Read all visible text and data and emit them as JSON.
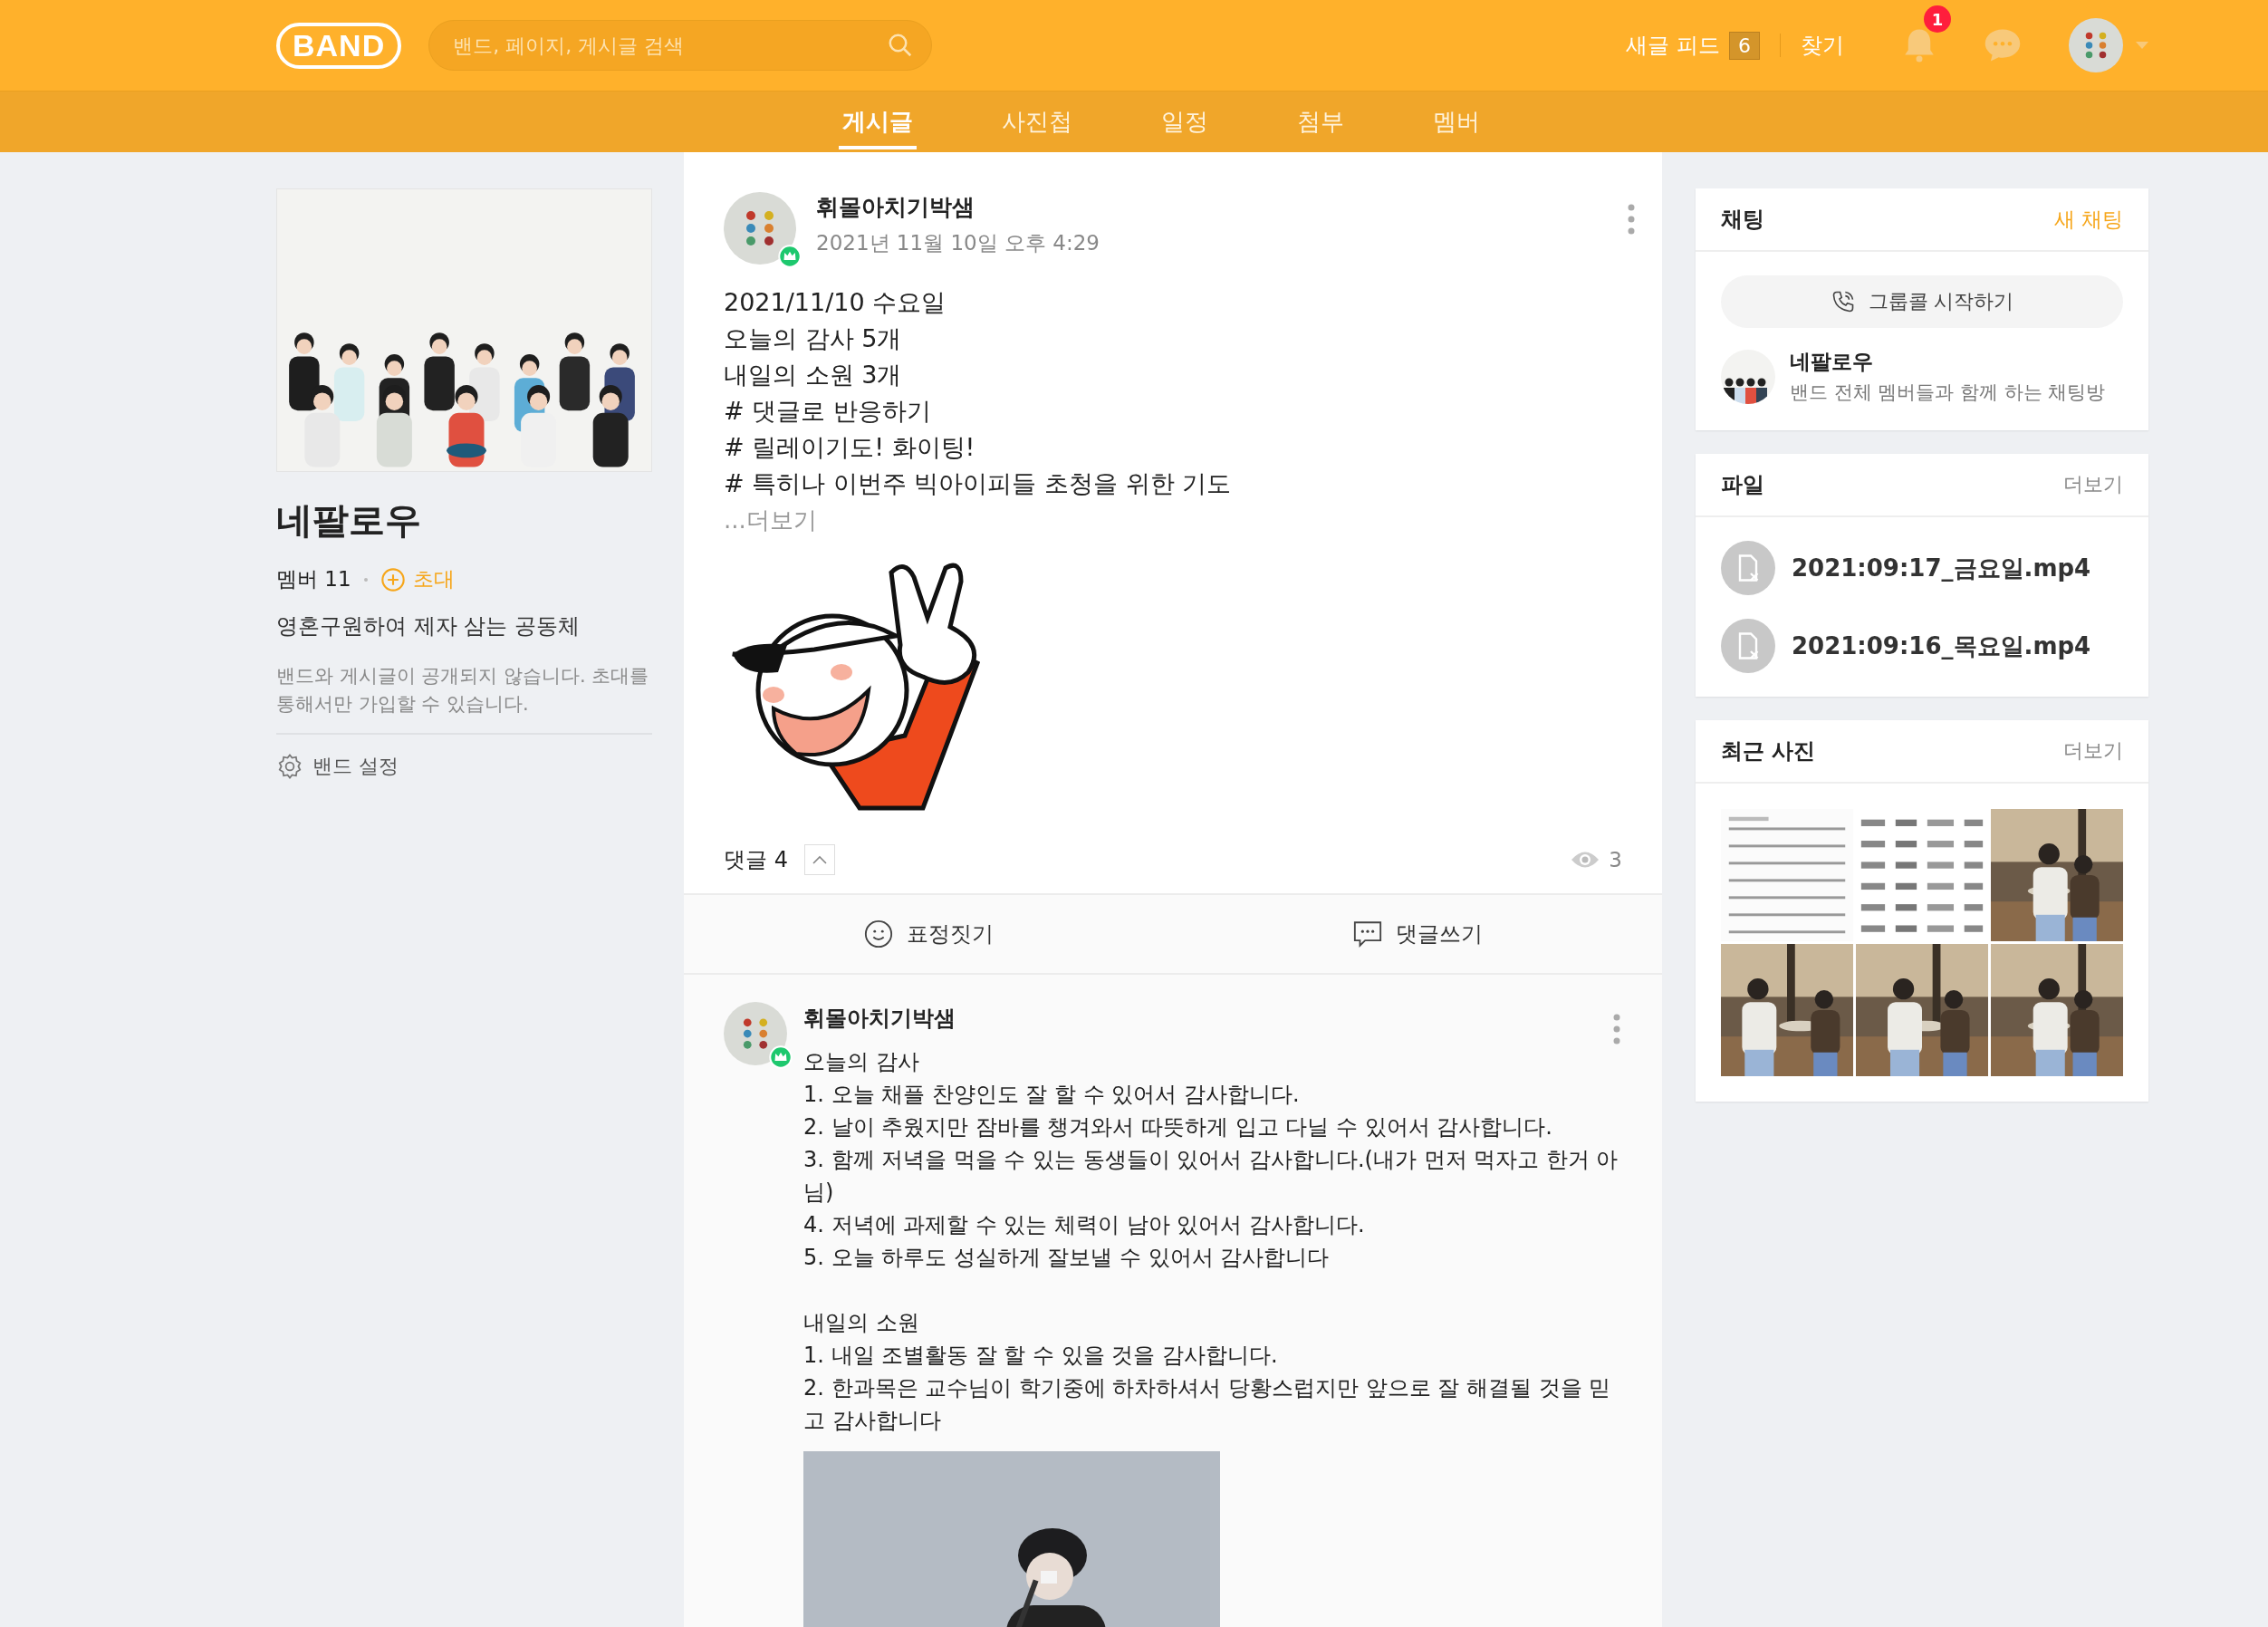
{
  "header": {
    "logo": "BAND",
    "search": {
      "placeholder": "밴드, 페이지, 게시글 검색"
    },
    "feed_label": "새글 피드",
    "feed_count": "6",
    "find": "찾기",
    "notification_count": "1"
  },
  "nav_tabs": [
    {
      "label": "게시글",
      "selected": true
    },
    {
      "label": "사진첩",
      "selected": false
    },
    {
      "label": "일정",
      "selected": false
    },
    {
      "label": "첨부",
      "selected": false
    },
    {
      "label": "멤버",
      "selected": false
    }
  ],
  "band": {
    "name": "네팔로우",
    "members": "멤버 11",
    "invite": "초대",
    "description": "영혼구원하여 제자 삼는 공동체",
    "privacy_note": "밴드와 게시글이 공개되지 않습니다. 초대를 통해서만 가입할 수 있습니다.",
    "settings": "밴드 설정"
  },
  "post": {
    "author": "휘몰아치기박샘",
    "time": "2021년 11월 10일 오후 4:29",
    "lines": [
      "2021/11/10 수요일",
      "오늘의 감사 5개",
      "내일의 소원 3개",
      "# 댓글로 반응하기",
      "# 릴레이기도! 화이팅!",
      "# 특히나 이번주 빅아이피들 초청을 위한 기도"
    ],
    "more": "...더보기",
    "comments_label": "댓글 4",
    "views": "3",
    "actions": [
      {
        "kind": "emotion",
        "label": "표정짓기"
      },
      {
        "kind": "comment",
        "label": "댓글쓰기"
      }
    ]
  },
  "comment": {
    "author": "휘몰아치기박샘",
    "paragraphs": [
      [
        "오늘의 감사",
        "1. 오늘 채플 찬양인도 잘 할 수 있어서 감사합니다.",
        "2. 날이 추웠지만 잠바를 챙겨와서 따뜻하게 입고 다닐 수 있어서 감사합니다.",
        "3. 함께 저녁을 먹을 수 있는 동생들이 있어서 감사합니다.(내가 먼저 먹자고 한거 아님)",
        "4. 저녁에 과제할 수 있는 체력이 남아 있어서 감사합니다.",
        "5. 오늘 하루도 성실하게 잘보낼 수 있어서 감사합니다"
      ],
      [
        "내일의 소원",
        "1. 내일 조별활동 잘 할 수 있을 것을 감사합니다.",
        "2. 한과목은 교수님이 학기중에 하차하셔서 당황스럽지만 앞으로 잘 해결될 것을 믿고 감사합니다"
      ]
    ]
  },
  "chat": {
    "title": "채팅",
    "new_chat": "새 채팅",
    "group_call": "그룹콜 시작하기",
    "room": {
      "name": "네팔로우",
      "description": "밴드 전체 멤버들과 함께 하는 채팅방"
    }
  },
  "files": {
    "title": "파일",
    "more": "더보기",
    "items": [
      "2021:09:17_금요일.mp4",
      "2021:09:16_목요일.mp4"
    ]
  },
  "recent_photos": {
    "title": "최근 사진",
    "more": "더보기"
  }
}
